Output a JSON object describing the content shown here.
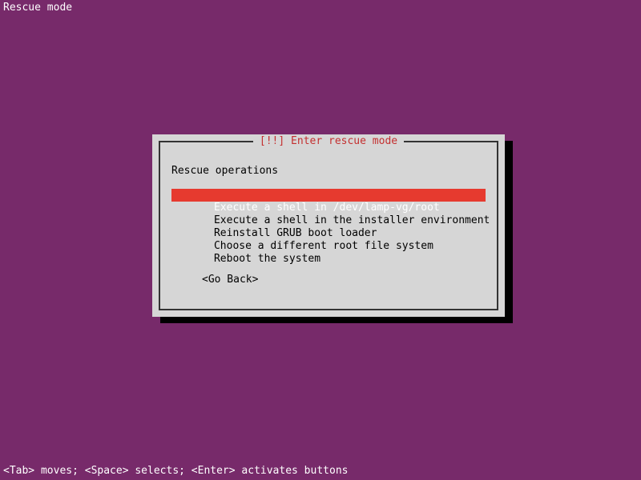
{
  "header": {
    "title": "Rescue mode"
  },
  "dialog": {
    "title": "[!!] Enter rescue mode",
    "subtitle": "Rescue operations",
    "menu": {
      "selected_index": 0,
      "items": [
        {
          "label": "Execute a shell in /dev/lamp-vg/root"
        },
        {
          "label": "Execute a shell in the installer environment"
        },
        {
          "label": "Reinstall GRUB boot loader"
        },
        {
          "label": "Choose a different root file system"
        },
        {
          "label": "Reboot the system"
        }
      ]
    },
    "go_back_label": "<Go Back>"
  },
  "footer": {
    "hint": "<Tab> moves; <Space> selects; <Enter> activates buttons"
  }
}
